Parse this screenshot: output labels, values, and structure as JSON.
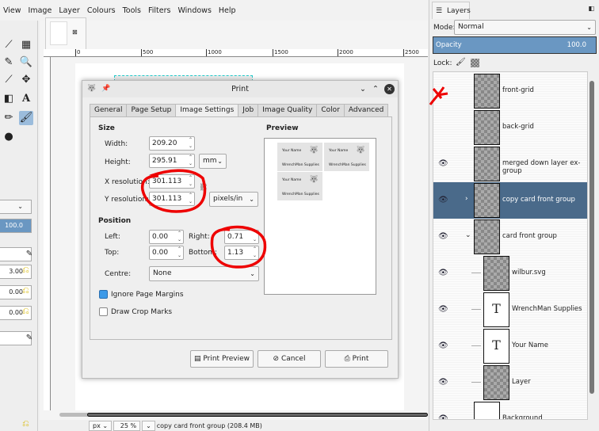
{
  "menubar": [
    "View",
    "Image",
    "Layer",
    "Colours",
    "Tools",
    "Filters",
    "Windows",
    "Help"
  ],
  "ruler": {
    "top_ticks": [
      "0",
      "500",
      "1000",
      "1500",
      "2000",
      "2500"
    ]
  },
  "tool_options": {
    "values": [
      "100.0",
      "3.00",
      "0.00",
      "0.00"
    ]
  },
  "status": {
    "unit": "px",
    "zoom": "25 %",
    "info": "copy card front group (208.4 MB)"
  },
  "dialog": {
    "title": "Print",
    "tabs": [
      "General",
      "Page Setup",
      "Image Settings",
      "Job",
      "Image Quality",
      "Color",
      "Advanced"
    ],
    "active_tab": "Image Settings",
    "size": {
      "heading": "Size",
      "width_label": "Width:",
      "width": "209.20",
      "height_label": "Height:",
      "height": "295.91",
      "unit": "mm",
      "xres_label": "X resolution:",
      "xres": "301.113",
      "yres_label": "Y resolution:",
      "yres": "301.113",
      "res_unit": "pixels/in"
    },
    "position": {
      "heading": "Position",
      "left_label": "Left:",
      "left": "0.00",
      "right_label": "Right:",
      "right": "0.71",
      "top_label": "Top:",
      "top": "0.00",
      "bottom_label": "Bottom:",
      "bottom": "1.13",
      "centre_label": "Centre:",
      "centre": "None"
    },
    "ignore_margins": {
      "label": "Ignore Page Margins",
      "checked": true
    },
    "crop_marks": {
      "label": "Draw Crop Marks",
      "checked": false
    },
    "preview": {
      "heading": "Preview",
      "card_name": "Your Name",
      "card_company": "WrenchMan Supplies"
    },
    "buttons": {
      "preview": "Print Preview",
      "cancel": "Cancel",
      "print": "Print"
    }
  },
  "layers": {
    "tab": "Layers",
    "mode_label": "Mode:",
    "mode": "Normal",
    "opacity_label": "Opacity",
    "opacity": "100.0",
    "lock_label": "Lock:",
    "items": [
      {
        "name": "front-grid",
        "visible": false
      },
      {
        "name": "back-grid",
        "visible": false
      },
      {
        "name": "merged down layer ex-group",
        "visible": true
      },
      {
        "name": "copy card front group",
        "visible": true,
        "selected": true
      },
      {
        "name": "card front group",
        "visible": true
      },
      {
        "name": "wilbur.svg",
        "visible": true
      },
      {
        "name": "WrenchMan Supplies",
        "visible": true
      },
      {
        "name": "Your Name",
        "visible": true
      },
      {
        "name": "Layer",
        "visible": true
      },
      {
        "name": "Background",
        "visible": true
      }
    ]
  },
  "colors": {
    "accent": "#6a97c2",
    "selected_row": "#4a6a8a",
    "annotation": "#ee0000"
  }
}
